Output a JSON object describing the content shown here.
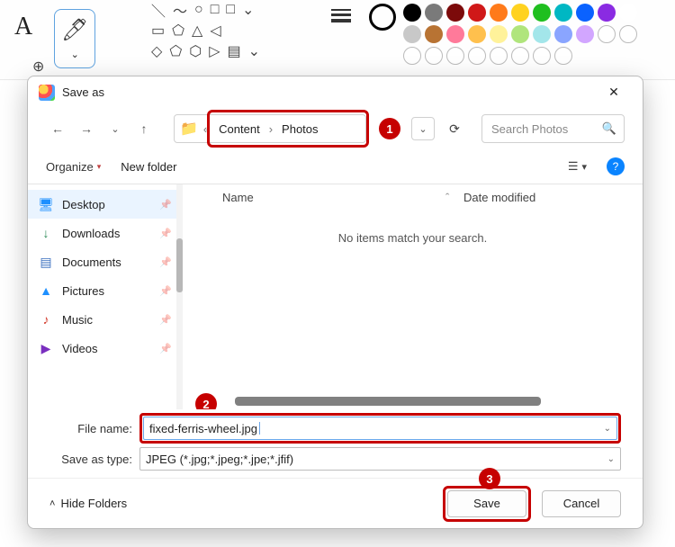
{
  "paint": {
    "text_tool": "A",
    "palette_colors": [
      "#000000",
      "#7a7a7a",
      "#7c0a0a",
      "#d01818",
      "#ff7a1a",
      "#ffd21f",
      "#1fbf1f",
      "#00b7c3",
      "#0a62ff",
      "#8a2be2"
    ],
    "palette_colors2": [
      "#ffffff",
      "#c8c8c8",
      "#b87333",
      "#ff7a9a",
      "#ffc04d",
      "#fff29a",
      "#b0e57c",
      "#a3e6ea",
      "#8aa5ff",
      "#d2a6ff"
    ]
  },
  "dialog": {
    "title": "Save as",
    "breadcrumb": {
      "prefix": "«",
      "seg1": "Content",
      "seg2": "Photos"
    },
    "search_placeholder": "Search Photos",
    "toolbar": {
      "organize": "Organize",
      "newfolder": "New folder"
    },
    "columns": {
      "name": "Name",
      "date": "Date modified",
      "sort": "ˆ"
    },
    "empty": "No items match your search.",
    "side_items": [
      {
        "label": "Desktop",
        "color": "#1e90ff",
        "glyph": "🖥"
      },
      {
        "label": "Downloads",
        "color": "#2e8b57",
        "glyph": "↓"
      },
      {
        "label": "Documents",
        "color": "#3a6fbf",
        "glyph": "▤"
      },
      {
        "label": "Pictures",
        "color": "#1e90ff",
        "glyph": "▲"
      },
      {
        "label": "Music",
        "color": "#d33a2c",
        "glyph": "♪"
      },
      {
        "label": "Videos",
        "color": "#7a2fbf",
        "glyph": "▶"
      }
    ],
    "fields": {
      "filename_label": "File name:",
      "filename_value": "fixed-ferris-wheel.jpg",
      "type_label": "Save as type:",
      "type_value": "JPEG (*.jpg;*.jpeg;*.jpe;*.jfif)"
    },
    "footer": {
      "hide": "Hide Folders",
      "save": "Save",
      "cancel": "Cancel"
    },
    "steps": {
      "s1": "1",
      "s2": "2",
      "s3": "3"
    }
  }
}
